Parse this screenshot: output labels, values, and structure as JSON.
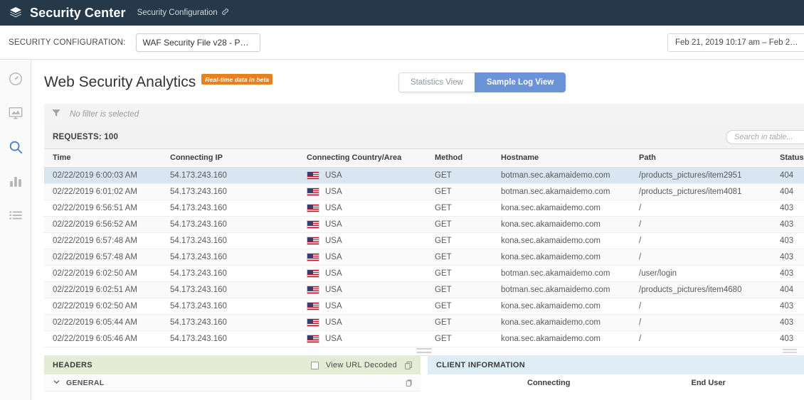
{
  "header": {
    "logo_icon": "layers-icon",
    "app_title": "Security Center",
    "sub_title": "Security Configuration",
    "link_icon": "link-icon"
  },
  "config_bar": {
    "label": "SECURITY CONFIGURATION:",
    "selected_config": "WAF Security File v28  -  P…",
    "date_range": "Feb 21, 2019  10:17 am  –  Feb 2…"
  },
  "sidebar": {
    "items": [
      {
        "name": "dashboard-icon",
        "active": false
      },
      {
        "name": "monitor-icon",
        "active": false
      },
      {
        "name": "search-icon",
        "active": true
      },
      {
        "name": "bar-chart-icon",
        "active": false
      },
      {
        "name": "list-icon",
        "active": false
      }
    ]
  },
  "page": {
    "title": "Web Security Analytics",
    "badge": "Real-time data in beta",
    "badge_color": "#e8801f"
  },
  "view_toggle": {
    "statistics_label": "Statistics View",
    "sample_log_label": "Sample Log View",
    "active": "Sample Log View",
    "active_color": "#6b93d8"
  },
  "filter": {
    "icon": "funnel-icon",
    "text": "No filter is selected"
  },
  "table_toolbar": {
    "requests_label": "REQUESTS: 100",
    "search_placeholder": "Search in table..."
  },
  "table": {
    "columns": [
      "Time",
      "Connecting IP",
      "Connecting Country/Area",
      "Method",
      "Hostname",
      "Path",
      "Status"
    ],
    "rows": [
      {
        "time": "02/22/2019 6:00:03 AM",
        "ip": "54.173.243.160",
        "country": "USA",
        "method": "GET",
        "hostname": "botman.sec.akamaidemo.com",
        "path": "/products_pictures/item2951",
        "status": "404",
        "selected": true
      },
      {
        "time": "02/22/2019 6:01:02 AM",
        "ip": "54.173.243.160",
        "country": "USA",
        "method": "GET",
        "hostname": "botman.sec.akamaidemo.com",
        "path": "/products_pictures/item4081",
        "status": "404",
        "selected": false
      },
      {
        "time": "02/22/2019 6:56:51 AM",
        "ip": "54.173.243.160",
        "country": "USA",
        "method": "GET",
        "hostname": "kona.sec.akamaidemo.com",
        "path": "/",
        "status": "403",
        "selected": false
      },
      {
        "time": "02/22/2019 6:56:52 AM",
        "ip": "54.173.243.160",
        "country": "USA",
        "method": "GET",
        "hostname": "kona.sec.akamaidemo.com",
        "path": "/",
        "status": "403",
        "selected": false
      },
      {
        "time": "02/22/2019 6:57:48 AM",
        "ip": "54.173.243.160",
        "country": "USA",
        "method": "GET",
        "hostname": "kona.sec.akamaidemo.com",
        "path": "/",
        "status": "403",
        "selected": false
      },
      {
        "time": "02/22/2019 6:57:48 AM",
        "ip": "54.173.243.160",
        "country": "USA",
        "method": "GET",
        "hostname": "kona.sec.akamaidemo.com",
        "path": "/",
        "status": "403",
        "selected": false
      },
      {
        "time": "02/22/2019 6:02:50 AM",
        "ip": "54.173.243.160",
        "country": "USA",
        "method": "GET",
        "hostname": "botman.sec.akamaidemo.com",
        "path": "/user/login",
        "status": "403",
        "selected": false
      },
      {
        "time": "02/22/2019 6:02:51 AM",
        "ip": "54.173.243.160",
        "country": "USA",
        "method": "GET",
        "hostname": "botman.sec.akamaidemo.com",
        "path": "/products_pictures/item4680",
        "status": "404",
        "selected": false
      },
      {
        "time": "02/22/2019 6:02:50 AM",
        "ip": "54.173.243.160",
        "country": "USA",
        "method": "GET",
        "hostname": "kona.sec.akamaidemo.com",
        "path": "/",
        "status": "403",
        "selected": false
      },
      {
        "time": "02/22/2019 6:05:44 AM",
        "ip": "54.173.243.160",
        "country": "USA",
        "method": "GET",
        "hostname": "kona.sec.akamaidemo.com",
        "path": "/",
        "status": "403",
        "selected": false
      },
      {
        "time": "02/22/2019 6:05:46 AM",
        "ip": "54.173.243.160",
        "country": "USA",
        "method": "GET",
        "hostname": "kona.sec.akamaidemo.com",
        "path": "/",
        "status": "403",
        "selected": false
      }
    ]
  },
  "headers_panel": {
    "title": "HEADERS",
    "view_url_decoded_label": "View URL Decoded",
    "copy_icon": "copy-icon",
    "section_label": "GENERAL",
    "chevron_icon": "chevron-down-icon",
    "section_copy_icon": "copy-icon",
    "accent_color": "#e4ecd5"
  },
  "client_panel": {
    "title": "CLIENT INFORMATION",
    "col_connecting": "Connecting",
    "col_end_user": "End User",
    "accent_color": "#dfedf7"
  }
}
